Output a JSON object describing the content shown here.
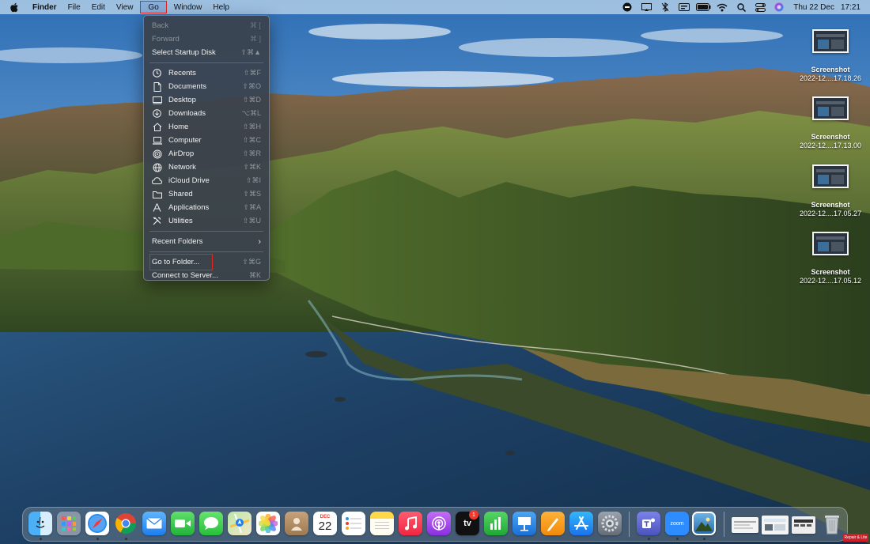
{
  "menubar": {
    "app_name": "Finder",
    "menus": [
      "File",
      "Edit",
      "View",
      "Go",
      "Window",
      "Help"
    ],
    "status_icons": [
      "record-icon",
      "screen-mirror-icon",
      "bluetooth-off-icon",
      "display-icon",
      "battery-icon",
      "wifi-icon",
      "search-icon",
      "control-center-icon",
      "siri-icon"
    ],
    "date": "Thu 22 Dec",
    "time": "17:21"
  },
  "go_menu": {
    "items": [
      {
        "label": "Back",
        "shortcut": "⌘ [",
        "disabled": true
      },
      {
        "label": "Forward",
        "shortcut": "⌘ ]",
        "disabled": true
      },
      {
        "label": "Select Startup Disk",
        "shortcut": "⇧⌘▲"
      },
      {
        "label": "Recents",
        "shortcut": "⇧⌘F",
        "icon": "clock-icon"
      },
      {
        "label": "Documents",
        "shortcut": "⇧⌘O",
        "icon": "document-icon"
      },
      {
        "label": "Desktop",
        "shortcut": "⇧⌘D",
        "icon": "desktop-icon"
      },
      {
        "label": "Downloads",
        "shortcut": "⌥⌘L",
        "icon": "download-icon"
      },
      {
        "label": "Home",
        "shortcut": "⇧⌘H",
        "icon": "home-icon"
      },
      {
        "label": "Computer",
        "shortcut": "⇧⌘C",
        "icon": "computer-icon"
      },
      {
        "label": "AirDrop",
        "shortcut": "⇧⌘R",
        "icon": "airdrop-icon"
      },
      {
        "label": "Network",
        "shortcut": "⇧⌘K",
        "icon": "network-icon"
      },
      {
        "label": "iCloud Drive",
        "shortcut": "⇧⌘I",
        "icon": "cloud-icon"
      },
      {
        "label": "Shared",
        "shortcut": "⇧⌘S",
        "icon": "shared-folder-icon"
      },
      {
        "label": "Applications",
        "shortcut": "⇧⌘A",
        "icon": "applications-icon"
      },
      {
        "label": "Utilities",
        "shortcut": "⇧⌘U",
        "icon": "utilities-icon"
      },
      {
        "label": "Recent Folders",
        "submenu": true
      },
      {
        "label": "Go to Folder...",
        "shortcut": "⇧⌘G",
        "highlighted": true
      },
      {
        "label": "Connect to Server...",
        "shortcut": "⌘K"
      }
    ]
  },
  "desktop_icons": [
    {
      "name": "Screenshot",
      "subtitle": "2022-12....17.18.26"
    },
    {
      "name": "Screenshot",
      "subtitle": "2022-12....17.13.00"
    },
    {
      "name": "Screenshot",
      "subtitle": "2022-12....17.05.27"
    },
    {
      "name": "Screenshot",
      "subtitle": "2022-12....17.05.12"
    }
  ],
  "dock": {
    "apps": [
      "Finder",
      "Launchpad",
      "Safari",
      "Google Chrome",
      "Mail",
      "FaceTime",
      "Messages",
      "Maps",
      "Photos",
      "Contacts",
      "Calendar",
      "Reminders",
      "Notes",
      "Music",
      "Podcasts",
      "TV",
      "Numbers",
      "Keynote",
      "Pages",
      "App Store",
      "System Preferences",
      "Microsoft Teams",
      "Zoom",
      "Preview"
    ],
    "calendar_month": "DEC",
    "calendar_day": "22",
    "tv_label": "tv",
    "tv_badge": "1",
    "zoom_label": "zoom"
  },
  "watermark_text": "Repair & Lite"
}
